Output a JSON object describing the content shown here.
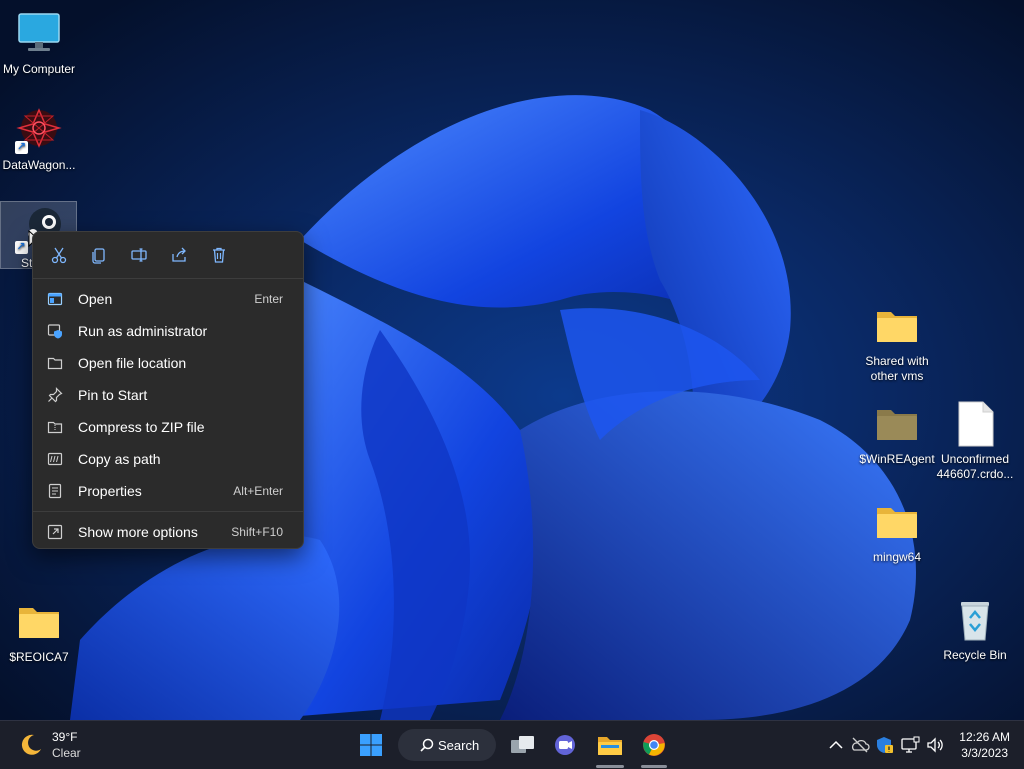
{
  "desktop": {
    "icons_left": [
      {
        "name": "My Computer"
      },
      {
        "name": "DataWagon..."
      },
      {
        "name": "St"
      },
      {
        "name": "$REOICA7"
      }
    ],
    "icons_right": [
      {
        "name": "Shared with other vms"
      },
      {
        "name": "$WinREAgent"
      },
      {
        "name": "Unconfirmed 446607.crdo..."
      },
      {
        "name": "mingw64"
      },
      {
        "name": "Recycle Bin"
      }
    ]
  },
  "context_menu": {
    "toolbar": [
      "cut-icon",
      "copy-icon",
      "rename-icon",
      "share-icon",
      "delete-icon"
    ],
    "items": [
      {
        "label": "Open",
        "shortcut": "Enter",
        "icon": "open-icon"
      },
      {
        "label": "Run as administrator",
        "shortcut": "",
        "icon": "shield-icon"
      },
      {
        "label": "Open file location",
        "shortcut": "",
        "icon": "folder-icon"
      },
      {
        "label": "Pin to Start",
        "shortcut": "",
        "icon": "pin-icon"
      },
      {
        "label": "Compress to ZIP file",
        "shortcut": "",
        "icon": "zip-icon"
      },
      {
        "label": "Copy as path",
        "shortcut": "",
        "icon": "path-icon"
      },
      {
        "label": "Properties",
        "shortcut": "Alt+Enter",
        "icon": "properties-icon"
      },
      {
        "label": "Show more options",
        "shortcut": "Shift+F10",
        "icon": "more-options-icon"
      }
    ]
  },
  "taskbar": {
    "weather": {
      "temp": "39°F",
      "condition": "Clear"
    },
    "search_label": "Search",
    "clock": {
      "time": "12:26 AM",
      "date": "3/3/2023"
    }
  }
}
